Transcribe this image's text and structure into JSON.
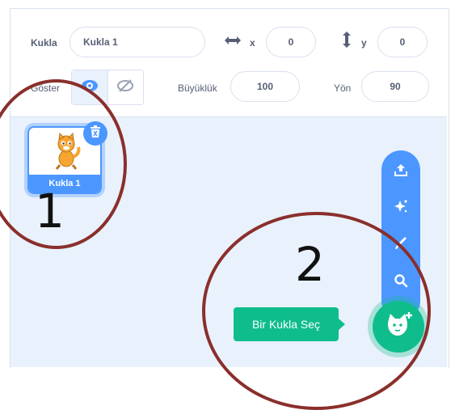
{
  "sprite_info": {
    "sprite_label": "Kukla",
    "sprite_name": "Kukla 1",
    "x_label": "x",
    "x_value": "0",
    "y_label": "y",
    "y_value": "0",
    "show_label": "Göster",
    "size_label": "Büyüklük",
    "size_value": "100",
    "direction_label": "Yön",
    "direction_value": "90"
  },
  "sprite_list": [
    {
      "name": "Kukla 1",
      "selected": true
    }
  ],
  "sprite_menu": {
    "items": [
      "upload-icon",
      "surprise-icon",
      "paint-icon",
      "search-icon"
    ],
    "main_button_tooltip": "Bir Kukla Seç",
    "main_button_icon": "cat-add-icon"
  },
  "annotations": {
    "label_1": "1",
    "label_2": "2"
  },
  "colors": {
    "accent_blue": "#4c97ff",
    "accent_green": "#0fbd8c",
    "annotation_red": "#8a2f2c",
    "panel_bg": "#e9f1fc"
  }
}
